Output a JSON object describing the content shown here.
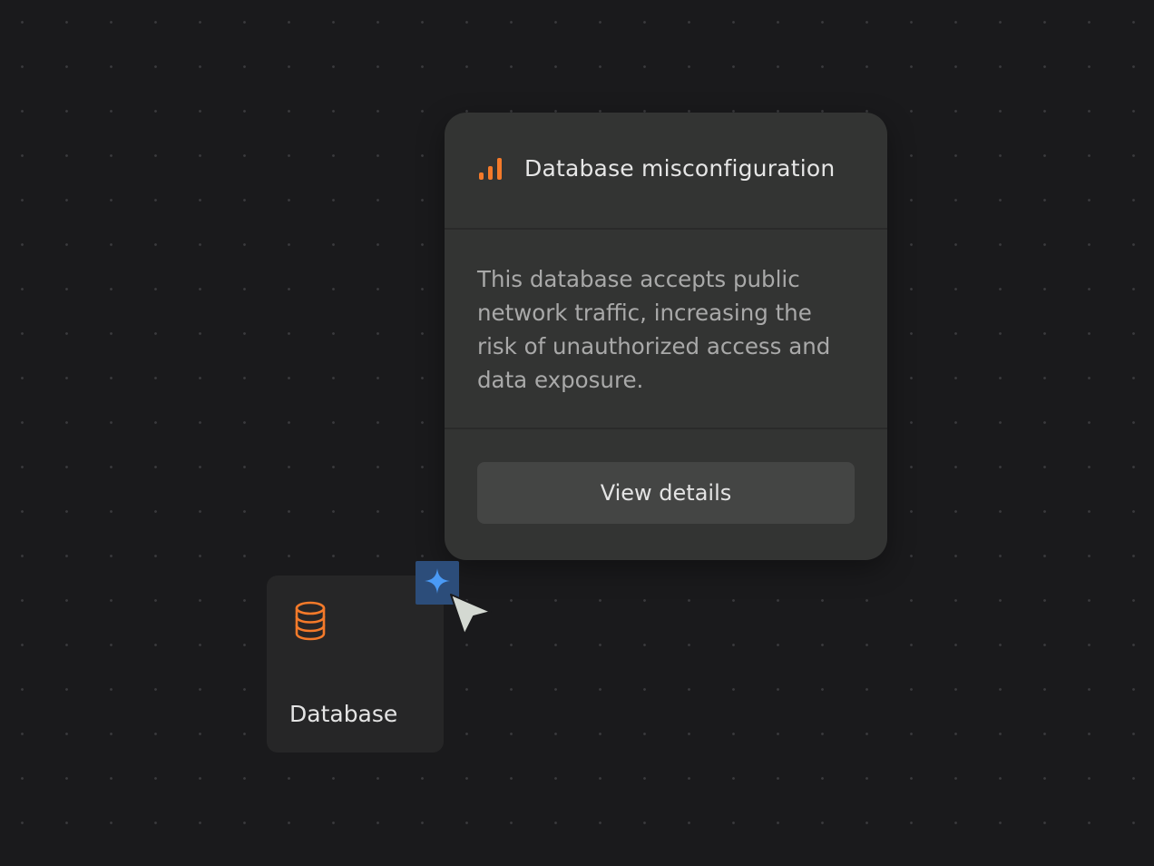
{
  "popover": {
    "title": "Database misconfiguration",
    "description": "This database accepts public network traffic, increasing the risk of unauthorized access and data exposure.",
    "button_label": "View details",
    "severity_icon": "signal-bars-icon"
  },
  "node": {
    "label": "Database",
    "icon": "database-icon"
  },
  "ai_badge": {
    "icon": "sparkle-icon"
  },
  "colors": {
    "accent_orange": "#f47a2a",
    "ai_blue": "#4a9af5",
    "badge_bg": "#2c4d7a",
    "background": "#1a1a1c"
  }
}
